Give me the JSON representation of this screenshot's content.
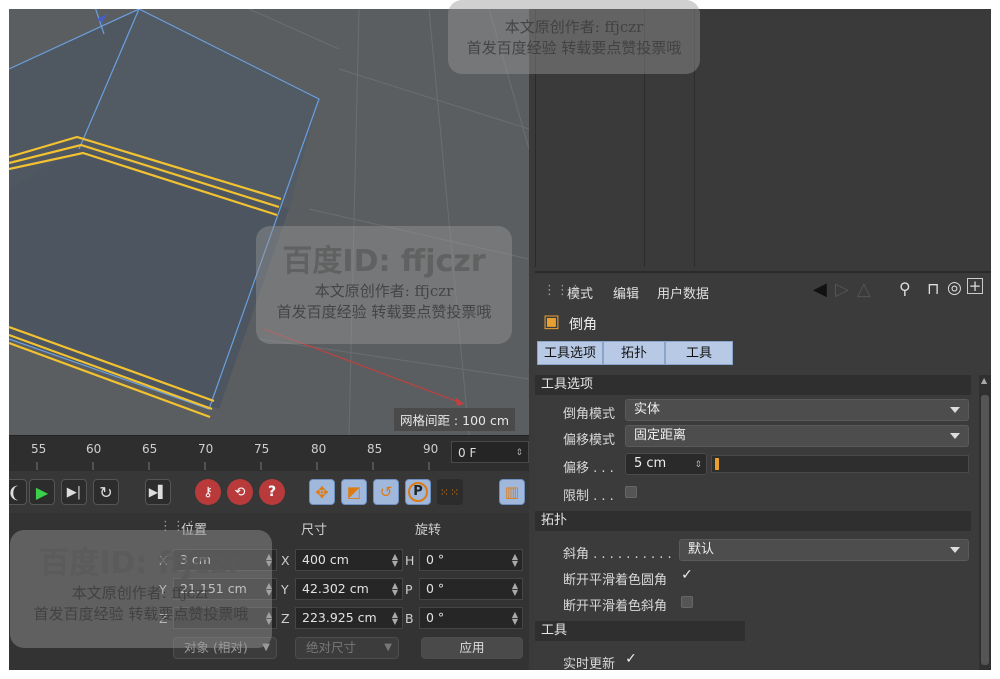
{
  "viewport": {
    "grid_label": "网格间距 : 100 cm"
  },
  "timeline": {
    "ticks": [
      "55",
      "60",
      "65",
      "70",
      "75",
      "80",
      "85",
      "90"
    ],
    "current_frame": "0 F"
  },
  "coord": {
    "headers": {
      "position": "位置",
      "size": "尺寸",
      "rotation": "旋转"
    },
    "rows": [
      {
        "pos_axis": "X",
        "pos_value": "3 cm",
        "size_axis": "X",
        "size_value": "400 cm",
        "rot_axis": "H",
        "rot_value": "0 °"
      },
      {
        "pos_axis": "Y",
        "pos_value": "21.151 cm",
        "size_axis": "Y",
        "size_value": "42.302 cm",
        "rot_axis": "P",
        "rot_value": "0 °"
      },
      {
        "pos_axis": "Z",
        "pos_value": "",
        "size_axis": "Z",
        "size_value": "223.925 cm",
        "rot_axis": "B",
        "rot_value": "0 °"
      }
    ],
    "mode_select": "对象 (相对)",
    "size_select": "绝对尺寸",
    "apply_label": "应用"
  },
  "attr": {
    "menu": [
      "模式",
      "编辑",
      "用户数据"
    ],
    "object_name": "倒角",
    "tabs": [
      "工具选项",
      "拓扑",
      "工具"
    ],
    "sections": {
      "tool_options": "工具选项",
      "topology": "拓扑",
      "tool": "工具"
    },
    "bevel_mode": {
      "label": "倒角模式",
      "value": "实体"
    },
    "offset_mode": {
      "label": "偏移模式",
      "value": "固定距离"
    },
    "offset": {
      "label": "偏移 . . .",
      "value": "5 cm"
    },
    "limit": {
      "label": "限制 . . .",
      "checked": false
    },
    "miter": {
      "label": "斜角 . . . . . . . . . .",
      "value": "默认"
    },
    "break_phong_rounding": {
      "label": "断开平滑着色圆角",
      "checked": true
    },
    "break_phong_miter": {
      "label": "断开平滑着色斜角",
      "checked": false
    },
    "realtime": {
      "label": "实时更新",
      "checked": true
    }
  },
  "watermark": {
    "brand": "百度ID: ffjczr",
    "line1": "本文原创作者: ffjczr",
    "line2": "首发百度经验 转载要点赞投票哦"
  },
  "colors": {
    "accent_yellow": "#f2c230",
    "edge_blue": "#6aa0e0",
    "tab_blue": "#b7c9e4"
  }
}
